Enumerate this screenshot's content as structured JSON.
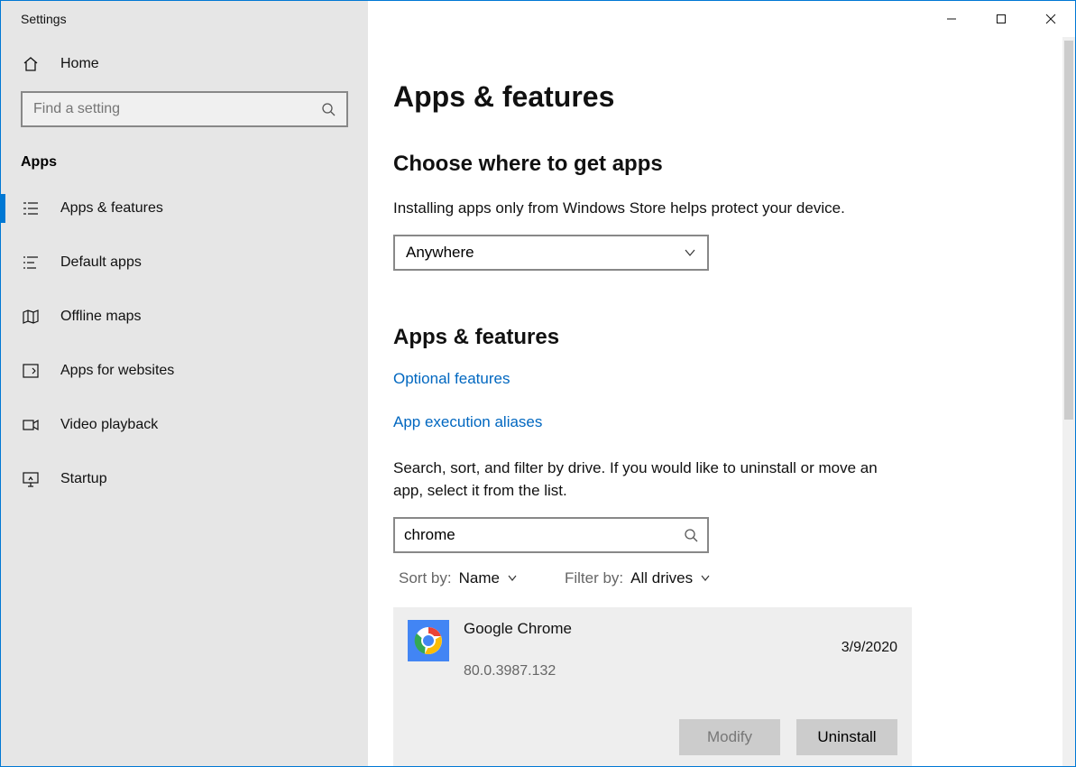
{
  "window": {
    "title": "Settings"
  },
  "sidebar": {
    "home": "Home",
    "search_placeholder": "Find a setting",
    "category": "Apps",
    "items": [
      {
        "label": "Apps & features",
        "icon": "apps-features-icon",
        "selected": true
      },
      {
        "label": "Default apps",
        "icon": "default-apps-icon"
      },
      {
        "label": "Offline maps",
        "icon": "offline-maps-icon"
      },
      {
        "label": "Apps for websites",
        "icon": "apps-websites-icon"
      },
      {
        "label": "Video playback",
        "icon": "video-playback-icon"
      },
      {
        "label": "Startup",
        "icon": "startup-icon"
      }
    ]
  },
  "content": {
    "heading": "Apps & features",
    "choose_heading": "Choose where to get apps",
    "choose_desc": "Installing apps only from Windows Store helps protect your device.",
    "choose_value": "Anywhere",
    "apps_heading": "Apps & features",
    "links": {
      "optional": "Optional features",
      "aliases": "App execution aliases"
    },
    "search_caption": "Search, sort, and filter by drive. If you would like to uninstall or move an app, select it from the list.",
    "search_value": "chrome",
    "sort": {
      "label": "Sort by:",
      "value": "Name"
    },
    "filter": {
      "label": "Filter by:",
      "value": "All drives"
    },
    "app": {
      "name": "Google Chrome",
      "version": "80.0.3987.132",
      "date": "3/9/2020",
      "modify": "Modify",
      "uninstall": "Uninstall"
    }
  }
}
